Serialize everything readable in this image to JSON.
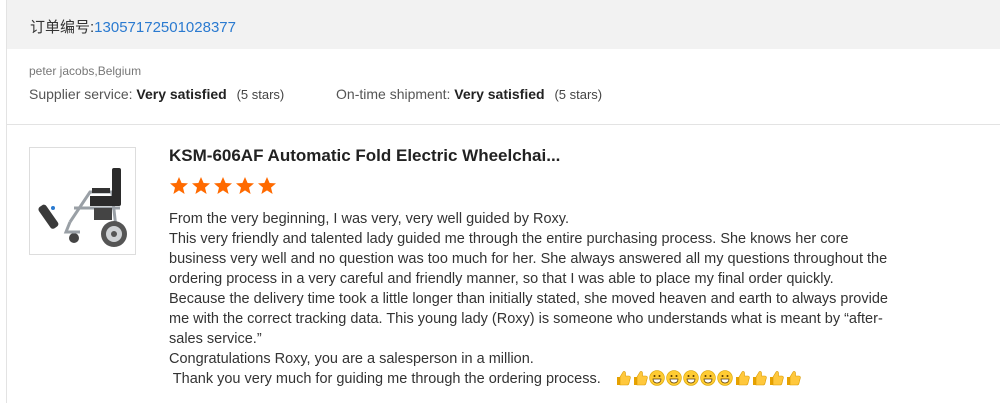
{
  "order": {
    "label": "订单编号:",
    "number": "13057172501028377"
  },
  "buyer": "peter jacobs,Belgium",
  "ratings": {
    "supplier_label": "Supplier service:",
    "supplier_value": "Very satisfied",
    "supplier_stars": "(5 stars)",
    "shipment_label": "On-time shipment:",
    "shipment_value": "Very satisfied",
    "shipment_stars": "(5 stars)"
  },
  "product": {
    "title": "KSM-606AF Automatic Fold Electric Wheelchai...",
    "image_icon": "wheelchair-image",
    "rating": 5,
    "star_color": "#ff6a00"
  },
  "review": {
    "lines": [
      "From the very beginning, I was very, very well guided by Roxy.",
      "This very friendly and talented lady guided me through the entire purchasing process. She knows her core business very well and no question was too much for her. She always answered all my questions throughout the ordering process in a very careful and friendly manner, so that I was able to place my final order quickly.",
      "Because the delivery time took a little longer than initially stated, she moved heaven and earth to always provide me with the correct tracking data. This young lady (Roxy) is someone who understands what is meant by “after-sales service.”",
      "Congratulations Roxy, you are a salesperson in a million.",
      " Thank you very much for guiding me through the ordering process."
    ],
    "emojis": [
      "thumbs-up",
      "thumbs-up",
      "grin",
      "grin",
      "grin",
      "grin",
      "grin",
      "thumbs-up",
      "thumbs-up",
      "thumbs-up",
      "thumbs-up"
    ]
  },
  "colors": {
    "order_number": "#2a7ad0",
    "header_bg": "#f2f2f2",
    "accent": "#ff6a00"
  }
}
